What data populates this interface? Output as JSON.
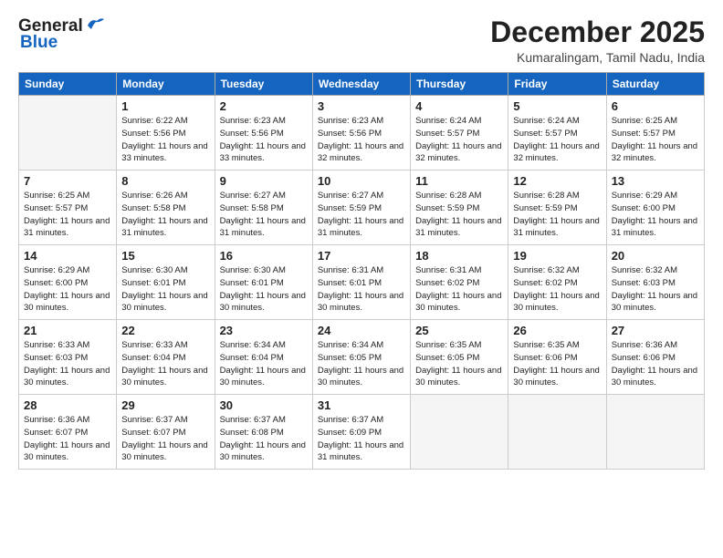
{
  "header": {
    "logo_general": "General",
    "logo_blue": "Blue",
    "month_title": "December 2025",
    "location": "Kumaralingam, Tamil Nadu, India"
  },
  "weekdays": [
    "Sunday",
    "Monday",
    "Tuesday",
    "Wednesday",
    "Thursday",
    "Friday",
    "Saturday"
  ],
  "weeks": [
    [
      {
        "day": "",
        "sunrise": "",
        "sunset": "",
        "daylight": ""
      },
      {
        "day": "1",
        "sunrise": "Sunrise: 6:22 AM",
        "sunset": "Sunset: 5:56 PM",
        "daylight": "Daylight: 11 hours and 33 minutes."
      },
      {
        "day": "2",
        "sunrise": "Sunrise: 6:23 AM",
        "sunset": "Sunset: 5:56 PM",
        "daylight": "Daylight: 11 hours and 33 minutes."
      },
      {
        "day": "3",
        "sunrise": "Sunrise: 6:23 AM",
        "sunset": "Sunset: 5:56 PM",
        "daylight": "Daylight: 11 hours and 32 minutes."
      },
      {
        "day": "4",
        "sunrise": "Sunrise: 6:24 AM",
        "sunset": "Sunset: 5:57 PM",
        "daylight": "Daylight: 11 hours and 32 minutes."
      },
      {
        "day": "5",
        "sunrise": "Sunrise: 6:24 AM",
        "sunset": "Sunset: 5:57 PM",
        "daylight": "Daylight: 11 hours and 32 minutes."
      },
      {
        "day": "6",
        "sunrise": "Sunrise: 6:25 AM",
        "sunset": "Sunset: 5:57 PM",
        "daylight": "Daylight: 11 hours and 32 minutes."
      }
    ],
    [
      {
        "day": "7",
        "sunrise": "Sunrise: 6:25 AM",
        "sunset": "Sunset: 5:57 PM",
        "daylight": "Daylight: 11 hours and 31 minutes."
      },
      {
        "day": "8",
        "sunrise": "Sunrise: 6:26 AM",
        "sunset": "Sunset: 5:58 PM",
        "daylight": "Daylight: 11 hours and 31 minutes."
      },
      {
        "day": "9",
        "sunrise": "Sunrise: 6:27 AM",
        "sunset": "Sunset: 5:58 PM",
        "daylight": "Daylight: 11 hours and 31 minutes."
      },
      {
        "day": "10",
        "sunrise": "Sunrise: 6:27 AM",
        "sunset": "Sunset: 5:59 PM",
        "daylight": "Daylight: 11 hours and 31 minutes."
      },
      {
        "day": "11",
        "sunrise": "Sunrise: 6:28 AM",
        "sunset": "Sunset: 5:59 PM",
        "daylight": "Daylight: 11 hours and 31 minutes."
      },
      {
        "day": "12",
        "sunrise": "Sunrise: 6:28 AM",
        "sunset": "Sunset: 5:59 PM",
        "daylight": "Daylight: 11 hours and 31 minutes."
      },
      {
        "day": "13",
        "sunrise": "Sunrise: 6:29 AM",
        "sunset": "Sunset: 6:00 PM",
        "daylight": "Daylight: 11 hours and 31 minutes."
      }
    ],
    [
      {
        "day": "14",
        "sunrise": "Sunrise: 6:29 AM",
        "sunset": "Sunset: 6:00 PM",
        "daylight": "Daylight: 11 hours and 30 minutes."
      },
      {
        "day": "15",
        "sunrise": "Sunrise: 6:30 AM",
        "sunset": "Sunset: 6:01 PM",
        "daylight": "Daylight: 11 hours and 30 minutes."
      },
      {
        "day": "16",
        "sunrise": "Sunrise: 6:30 AM",
        "sunset": "Sunset: 6:01 PM",
        "daylight": "Daylight: 11 hours and 30 minutes."
      },
      {
        "day": "17",
        "sunrise": "Sunrise: 6:31 AM",
        "sunset": "Sunset: 6:01 PM",
        "daylight": "Daylight: 11 hours and 30 minutes."
      },
      {
        "day": "18",
        "sunrise": "Sunrise: 6:31 AM",
        "sunset": "Sunset: 6:02 PM",
        "daylight": "Daylight: 11 hours and 30 minutes."
      },
      {
        "day": "19",
        "sunrise": "Sunrise: 6:32 AM",
        "sunset": "Sunset: 6:02 PM",
        "daylight": "Daylight: 11 hours and 30 minutes."
      },
      {
        "day": "20",
        "sunrise": "Sunrise: 6:32 AM",
        "sunset": "Sunset: 6:03 PM",
        "daylight": "Daylight: 11 hours and 30 minutes."
      }
    ],
    [
      {
        "day": "21",
        "sunrise": "Sunrise: 6:33 AM",
        "sunset": "Sunset: 6:03 PM",
        "daylight": "Daylight: 11 hours and 30 minutes."
      },
      {
        "day": "22",
        "sunrise": "Sunrise: 6:33 AM",
        "sunset": "Sunset: 6:04 PM",
        "daylight": "Daylight: 11 hours and 30 minutes."
      },
      {
        "day": "23",
        "sunrise": "Sunrise: 6:34 AM",
        "sunset": "Sunset: 6:04 PM",
        "daylight": "Daylight: 11 hours and 30 minutes."
      },
      {
        "day": "24",
        "sunrise": "Sunrise: 6:34 AM",
        "sunset": "Sunset: 6:05 PM",
        "daylight": "Daylight: 11 hours and 30 minutes."
      },
      {
        "day": "25",
        "sunrise": "Sunrise: 6:35 AM",
        "sunset": "Sunset: 6:05 PM",
        "daylight": "Daylight: 11 hours and 30 minutes."
      },
      {
        "day": "26",
        "sunrise": "Sunrise: 6:35 AM",
        "sunset": "Sunset: 6:06 PM",
        "daylight": "Daylight: 11 hours and 30 minutes."
      },
      {
        "day": "27",
        "sunrise": "Sunrise: 6:36 AM",
        "sunset": "Sunset: 6:06 PM",
        "daylight": "Daylight: 11 hours and 30 minutes."
      }
    ],
    [
      {
        "day": "28",
        "sunrise": "Sunrise: 6:36 AM",
        "sunset": "Sunset: 6:07 PM",
        "daylight": "Daylight: 11 hours and 30 minutes."
      },
      {
        "day": "29",
        "sunrise": "Sunrise: 6:37 AM",
        "sunset": "Sunset: 6:07 PM",
        "daylight": "Daylight: 11 hours and 30 minutes."
      },
      {
        "day": "30",
        "sunrise": "Sunrise: 6:37 AM",
        "sunset": "Sunset: 6:08 PM",
        "daylight": "Daylight: 11 hours and 30 minutes."
      },
      {
        "day": "31",
        "sunrise": "Sunrise: 6:37 AM",
        "sunset": "Sunset: 6:09 PM",
        "daylight": "Daylight: 11 hours and 31 minutes."
      },
      {
        "day": "",
        "sunrise": "",
        "sunset": "",
        "daylight": ""
      },
      {
        "day": "",
        "sunrise": "",
        "sunset": "",
        "daylight": ""
      },
      {
        "day": "",
        "sunrise": "",
        "sunset": "",
        "daylight": ""
      }
    ]
  ]
}
